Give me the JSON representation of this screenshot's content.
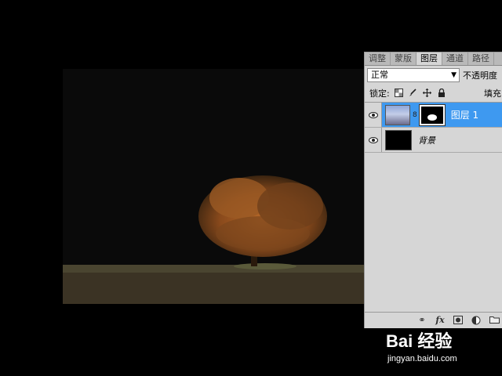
{
  "panel": {
    "tabs": [
      {
        "label": "调整"
      },
      {
        "label": "蒙版"
      },
      {
        "label": "图层"
      },
      {
        "label": "通道"
      },
      {
        "label": "路径"
      }
    ],
    "blend_mode": "正常",
    "opacity_label": "不透明度",
    "lock_label": "锁定:",
    "fill_label": "填充",
    "layers": [
      {
        "name": "图层 1",
        "selected": true
      },
      {
        "name": "背景",
        "selected": false
      }
    ]
  },
  "watermark": {
    "logo": "Bai 经验",
    "url": "jingyan.baidu.com"
  },
  "colors": {
    "selection": "#3e99f0",
    "panel_bg": "#d6d6d6",
    "canvas_bg": "#000000"
  }
}
